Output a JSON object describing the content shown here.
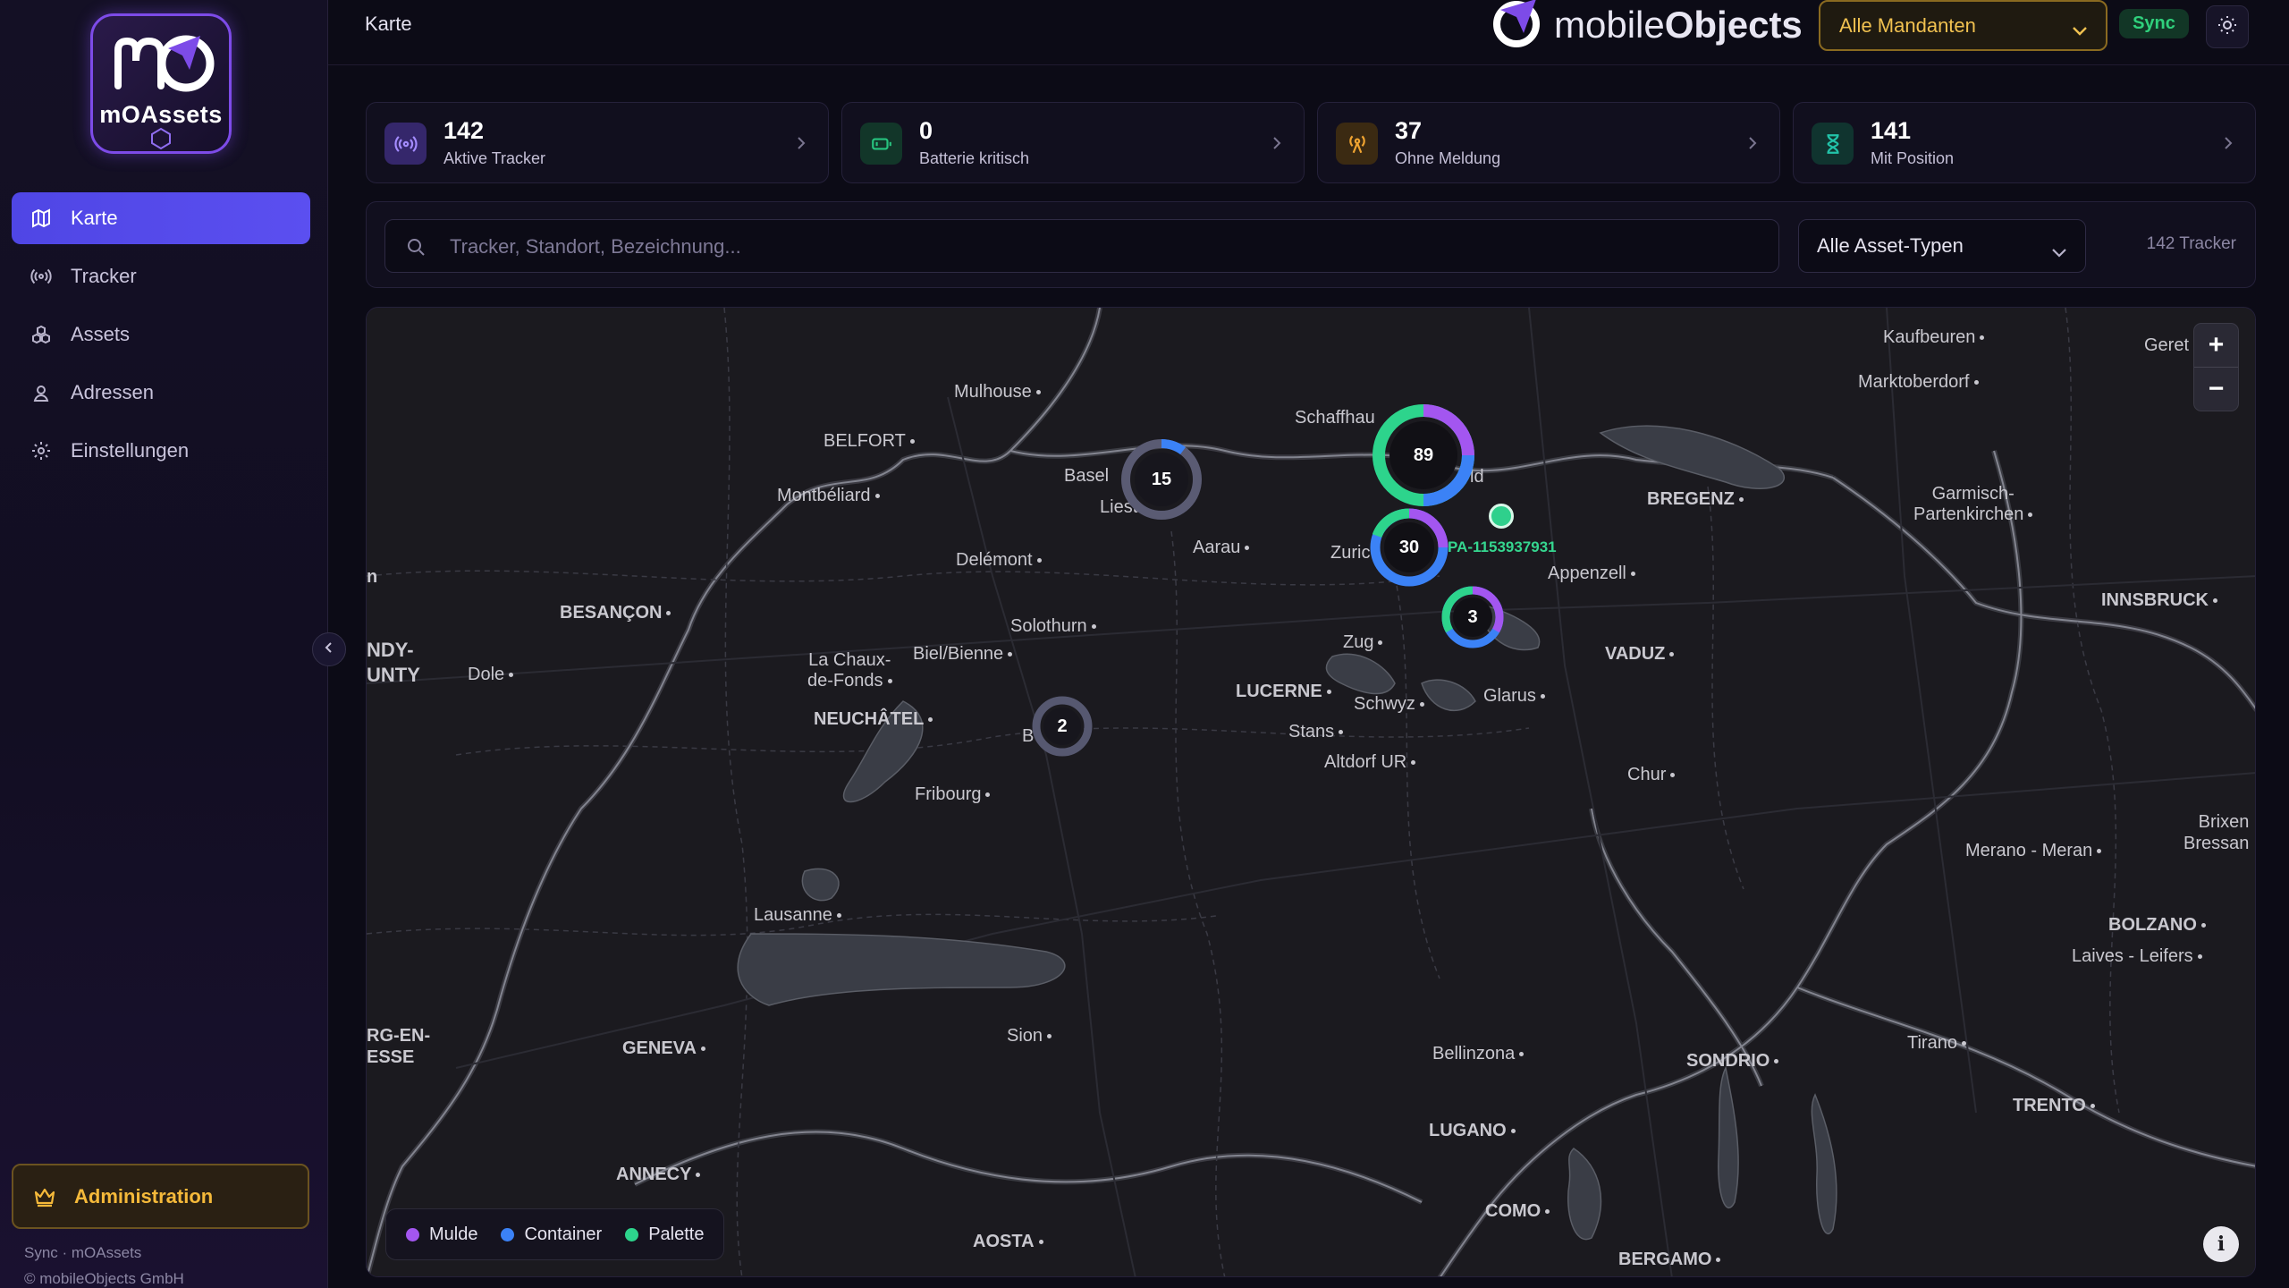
{
  "sidebar": {
    "logo_text": "mOAssets",
    "items": [
      {
        "label": "Karte",
        "icon": "map-icon"
      },
      {
        "label": "Tracker",
        "icon": "broadcast-icon"
      },
      {
        "label": "Assets",
        "icon": "boxes-icon"
      },
      {
        "label": "Adressen",
        "icon": "person-pin-icon"
      },
      {
        "label": "Einstellungen",
        "icon": "gear-icon"
      }
    ],
    "admin_label": "Administration",
    "footer_sync": "Sync · mOAssets",
    "footer_copyright": "© mobileObjects GmbH"
  },
  "header": {
    "page_title": "Karte",
    "brand_light": "mobile",
    "brand_bold": "Objects",
    "mandant": "Alle Mandanten",
    "sync": "Sync"
  },
  "stats": [
    {
      "value": "142",
      "label": "Aktive Tracker",
      "color": "#7c5cf0"
    },
    {
      "value": "0",
      "label": "Batterie kritisch",
      "color": "#20c47c"
    },
    {
      "value": "37",
      "label": "Ohne Meldung",
      "color": "#f0a431"
    },
    {
      "value": "141",
      "label": "Mit Position",
      "color": "#22c3a9"
    }
  ],
  "search": {
    "placeholder": "Tracker, Standort, Bezeichnung...",
    "asset_type": "Alle Asset-Typen",
    "count": "142 Tracker"
  },
  "map": {
    "cities": [
      {
        "name": "Mulhouse",
        "bold": false
      },
      {
        "name": "BELFORT",
        "bold": true
      },
      {
        "name": "Montbéliard",
        "bold": false
      },
      {
        "name": "Basel",
        "bold": false
      },
      {
        "name": "Liest",
        "bold": false
      },
      {
        "name": "Schaffhau",
        "bold": false
      },
      {
        "name": "ld",
        "bold": false
      },
      {
        "name": "Aarau",
        "bold": false
      },
      {
        "name": "Delémont",
        "bold": false
      },
      {
        "name": "Zuric",
        "bold": false
      },
      {
        "name": "BREGENZ",
        "bold": true
      },
      {
        "name": "Appenzell",
        "bold": false
      },
      {
        "name": "BESANÇON",
        "bold": true
      },
      {
        "name": "Solothurn",
        "bold": false
      },
      {
        "name": "La Chaux-\nde-Fonds",
        "bold": false
      },
      {
        "name": "Biel/Bienne",
        "bold": false
      },
      {
        "name": "Zug",
        "bold": false
      },
      {
        "name": "VADUZ",
        "bold": true
      },
      {
        "name": "Dole",
        "bold": false
      },
      {
        "name": "NEUCHÂTEL",
        "bold": true
      },
      {
        "name": "B",
        "bold": false
      },
      {
        "name": "LUCERNE",
        "bold": true
      },
      {
        "name": "Schwyz",
        "bold": false
      },
      {
        "name": "Glarus",
        "bold": false
      },
      {
        "name": "Stans",
        "bold": false
      },
      {
        "name": "Altdorf UR",
        "bold": false
      },
      {
        "name": "Fribourg",
        "bold": false
      },
      {
        "name": "Chur",
        "bold": false
      },
      {
        "name": "Lausanne",
        "bold": false
      },
      {
        "name": "GENEVA",
        "bold": true
      },
      {
        "name": "Sion",
        "bold": false
      },
      {
        "name": "Bellinzona",
        "bold": false
      },
      {
        "name": "SONDRIO",
        "bold": true
      },
      {
        "name": "Tirano",
        "bold": false
      },
      {
        "name": "LUGANO",
        "bold": true
      },
      {
        "name": "COMO",
        "bold": true
      },
      {
        "name": "ANNECY",
        "bold": true
      },
      {
        "name": "AOSTA",
        "bold": true
      },
      {
        "name": "BERGAMO",
        "bold": true
      },
      {
        "name": "Kaufbeuren",
        "bold": false
      },
      {
        "name": "Marktoberdorf",
        "bold": false
      },
      {
        "name": "Geret",
        "bold": false
      },
      {
        "name": "Garmisch-\nPartenkirchen",
        "bold": false
      },
      {
        "name": "INNSBRUCK",
        "bold": true
      },
      {
        "name": "Merano - Meran",
        "bold": false
      },
      {
        "name": "Brixen\nBressan",
        "bold": false
      },
      {
        "name": "BOLZANO",
        "bold": true
      },
      {
        "name": "Laives - Leifers",
        "bold": false
      },
      {
        "name": "TRENTO",
        "bold": true
      },
      {
        "name": "NDY-\nUNTY",
        "bold": true
      },
      {
        "name": "n",
        "bold": true
      },
      {
        "name": "RG-EN-\nESSE",
        "bold": true
      }
    ],
    "clusters": [
      {
        "count": "15"
      },
      {
        "count": "89"
      },
      {
        "count": "30"
      },
      {
        "count": "3"
      },
      {
        "count": "2"
      }
    ],
    "marker_label": "PA-1153937931",
    "zoom_in": "+",
    "zoom_out": "−",
    "info": "i",
    "legend": [
      {
        "label": "Mulde",
        "color": "#a356f0"
      },
      {
        "label": "Container",
        "color": "#3b82f6"
      },
      {
        "label": "Palette",
        "color": "#2dd48c"
      }
    ]
  }
}
